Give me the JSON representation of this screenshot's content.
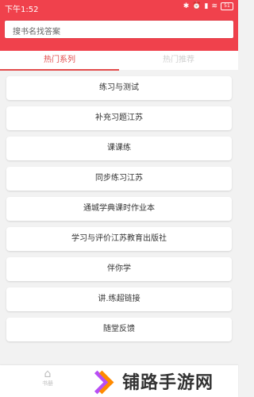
{
  "status": {
    "time": "下午1:52",
    "battery_level": "51"
  },
  "search": {
    "placeholder": "搜书名找答案"
  },
  "tabs": [
    {
      "label": "热门系列",
      "active": true
    },
    {
      "label": "热门推荐",
      "active": false
    }
  ],
  "list": {
    "items": [
      "练习与测试",
      "补充习题江苏",
      "课课练",
      "同步练习江苏",
      "通城学典课时作业本",
      "学习与评价江苏教育出版社",
      "伴你学",
      "讲.练超链接",
      "随堂反馈"
    ]
  },
  "bottom_nav": {
    "home_label": "书册"
  },
  "watermark": {
    "text": "铺路手游网"
  },
  "colors": {
    "header": "#f0414c",
    "tab_active": "#e24b4b"
  }
}
